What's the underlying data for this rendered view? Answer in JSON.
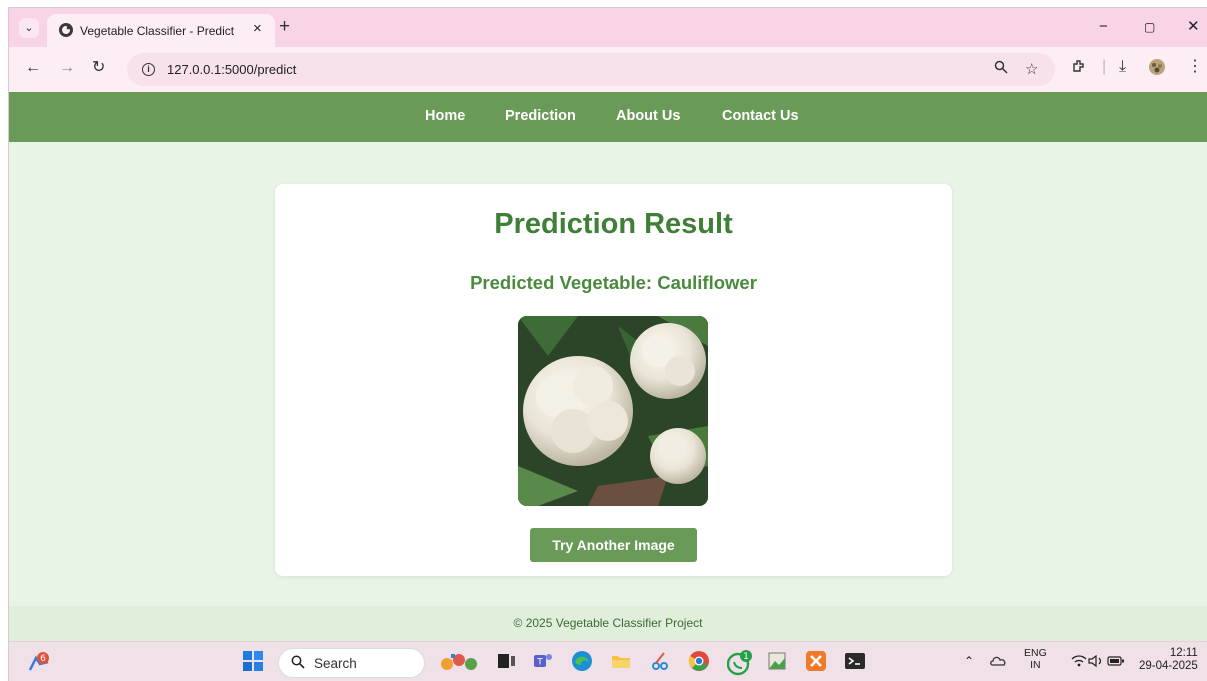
{
  "browser": {
    "tab_title": "Vegetable Classifier - Predict",
    "tab_close_glyph": "×",
    "new_tab_glyph": "+",
    "url": "127.0.0.1:5000/predict",
    "window_controls": [
      "−",
      "▢",
      "✕"
    ]
  },
  "navbar": {
    "links": [
      "Home",
      "Prediction",
      "About Us",
      "Contact Us"
    ]
  },
  "result": {
    "title": "Prediction Result",
    "predicted_label": "Predicted Vegetable:",
    "predicted_value": "Cauliflower",
    "image_icon": "cauliflower-photo",
    "button_label": "Try Another Image"
  },
  "footer": {
    "text": "© 2025 Vegetable Classifier Project"
  },
  "taskbar": {
    "search_label": "Search",
    "notification_count": "6",
    "whatsapp_badge": "1",
    "lang_top": "ENG",
    "lang_bottom": "IN",
    "time": "12:11",
    "date": "29-04-2025"
  },
  "colors": {
    "nav_green": "#6a9a58",
    "title_green": "#3f7f38",
    "page_bg": "#e8f4e6",
    "tab_strip_pink": "#f8d4e6"
  }
}
